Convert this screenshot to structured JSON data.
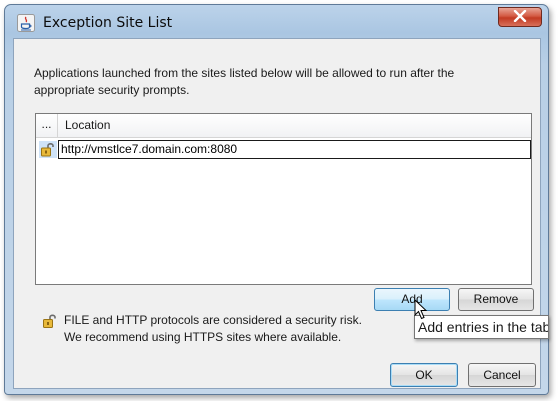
{
  "window": {
    "title": "Exception Site List",
    "icon": "java-icon",
    "close_icon": "close-icon"
  },
  "message": "Applications launched from the sites listed below will be allowed to run after the appropriate security prompts.",
  "table": {
    "columns": [
      "...",
      "Location"
    ],
    "rows": [
      {
        "icon": "unlock-icon",
        "location": "http://vmstlce7.domain.com:8080"
      }
    ]
  },
  "buttons": {
    "add": "Add",
    "remove": "Remove",
    "ok": "OK",
    "cancel": "Cancel"
  },
  "tooltip": "Add entries in the tab",
  "warning": {
    "icon": "unlock-icon",
    "line1": "FILE and HTTP protocols are considered a security risk.",
    "line2": "We recommend using HTTPS sites where available."
  },
  "colors": {
    "title_bar": "#aac6e2",
    "close_button": "#c23b23",
    "default_button_border": "#3c7fb1",
    "dialog_background": "#f0f0f0"
  }
}
